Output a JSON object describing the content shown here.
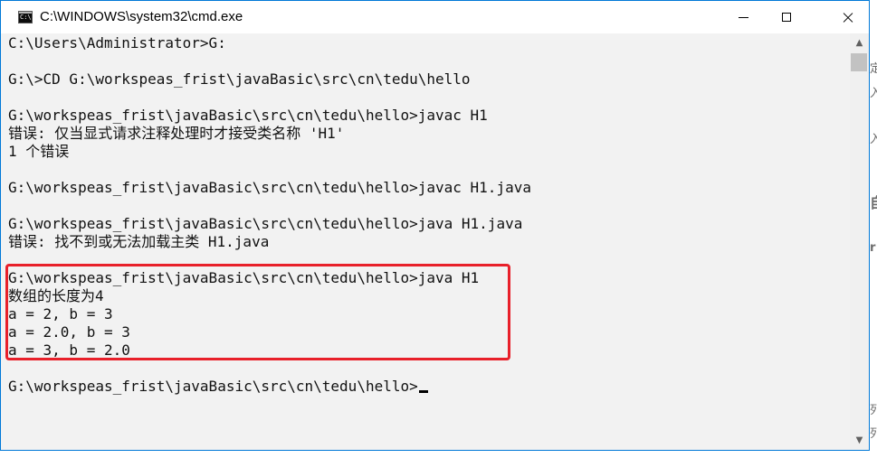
{
  "window": {
    "title": "C:\\WINDOWS\\system32\\cmd.exe",
    "icon": "cmd-icon",
    "controls": {
      "minimize": "minimize-icon",
      "maximize": "maximize-icon",
      "close": "close-icon"
    }
  },
  "console": {
    "lines": [
      "C:\\Users\\Administrator>G:",
      "",
      "G:\\>CD G:\\workspeas_frist\\javaBasic\\src\\cn\\tedu\\hello",
      "",
      "G:\\workspeas_frist\\javaBasic\\src\\cn\\tedu\\hello>javac H1",
      "错误: 仅当显式请求注释处理时才接受类名称 'H1'",
      "1 个错误",
      "",
      "G:\\workspeas_frist\\javaBasic\\src\\cn\\tedu\\hello>javac H1.java",
      "",
      "G:\\workspeas_frist\\javaBasic\\src\\cn\\tedu\\hello>java H1.java",
      "错误: 找不到或无法加载主类 H1.java",
      "",
      "G:\\workspeas_frist\\javaBasic\\src\\cn\\tedu\\hello>java H1",
      "数组的长度为4",
      "a = 2, b = 3",
      "a = 2.0, b = 3",
      "a = 3, b = 2.0",
      "",
      "G:\\workspeas_frist\\javaBasic\\src\\cn\\tedu\\hello>"
    ],
    "highlight_color": "#e8202a",
    "text_color": "#111111",
    "background": "#f2f2f2"
  },
  "scrollbar": {
    "up_arrow": "▲",
    "down_arrow": "▼"
  },
  "colors": {
    "window_border": "#0078d7"
  }
}
